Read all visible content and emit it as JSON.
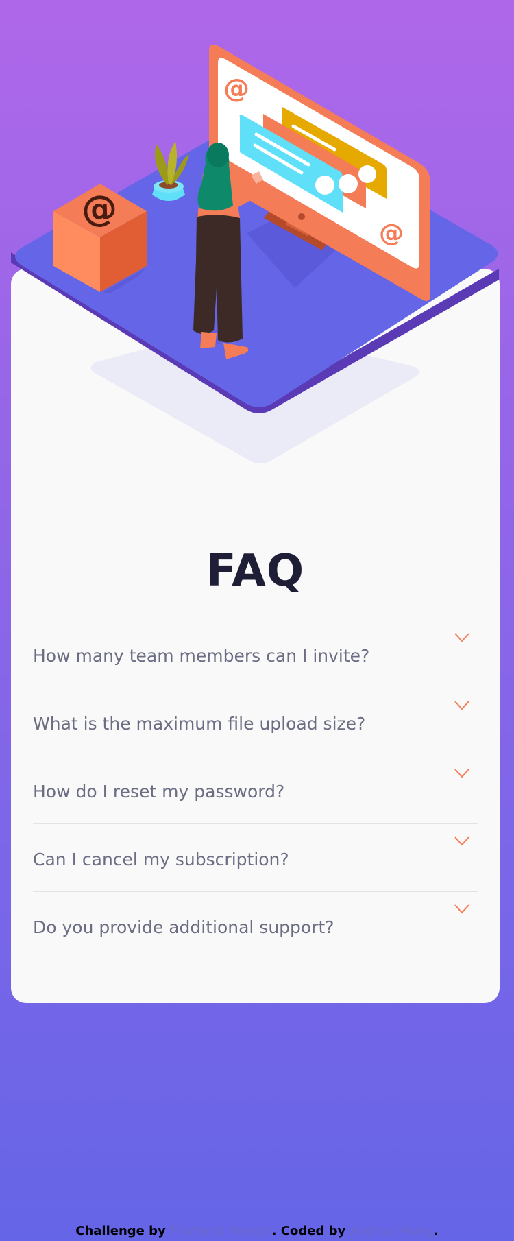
{
  "page": {
    "title": "FAQ"
  },
  "faq": {
    "items": [
      {
        "question": "How many team members can I invite?"
      },
      {
        "question": "What is the maximum file upload size?"
      },
      {
        "question": "How do I reset my password?"
      },
      {
        "question": "Can I cancel my subscription?"
      },
      {
        "question": "Do you provide additional support?"
      }
    ],
    "toggle_icon": "chevron-down-icon"
  },
  "attribution": {
    "challenge_prefix": "Challenge by ",
    "challenge_link": "Frontend Mentor",
    "coded_prefix": ". Coded by ",
    "coded_link": "Andrea Hideg",
    "suffix": "."
  },
  "colors": {
    "background_top": "#af67e9",
    "background_bottom": "#6565e7",
    "card": "#f9f9f9",
    "title": "#1e1f36",
    "question_text": "#6b6d83",
    "accent": "#f47c57",
    "divider": "#e2e2e7"
  }
}
